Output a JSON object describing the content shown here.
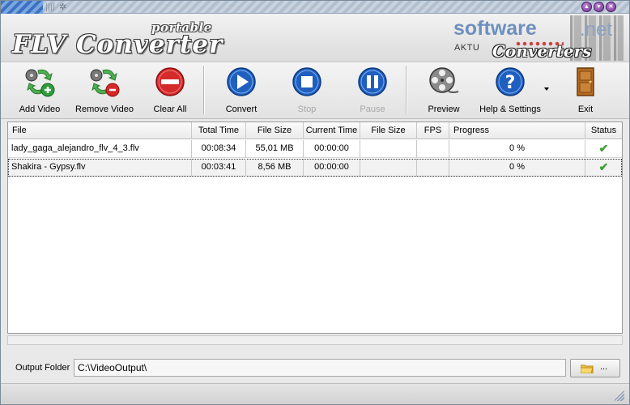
{
  "app": {
    "logo_portable": "portable",
    "logo_title": "FLV Converter",
    "brand_site": "software",
    "brand_tld": ".net",
    "brand_aktu": "AKTU",
    "brand_converters": "Converters",
    "window_controls": [
      "minimize-icon",
      "maximize-icon",
      "close-icon"
    ]
  },
  "toolbar": {
    "add_video": "Add Video",
    "remove_video": "Remove Video",
    "clear_all": "Clear All",
    "convert": "Convert",
    "stop": "Stop",
    "pause": "Pause",
    "preview": "Preview",
    "help_settings": "Help & Settings",
    "exit": "Exit",
    "disabled": [
      "Stop",
      "Pause"
    ]
  },
  "table": {
    "columns": [
      "File",
      "Total Time",
      "File Size",
      "Current Time",
      "File Size",
      "FPS",
      "Progress",
      "Status"
    ],
    "rows": [
      {
        "file": "lady_gaga_alejandro_flv_4_3.flv",
        "total_time": "00:08:34",
        "file_size": "55,01 MB",
        "current_time": "00:00:00",
        "out_size": "",
        "fps": "",
        "progress": "0 %",
        "status": "check-icon"
      },
      {
        "file": "Shakira - Gypsy.flv",
        "total_time": "00:03:41",
        "file_size": "8,56 MB",
        "current_time": "00:00:00",
        "out_size": "",
        "fps": "",
        "progress": "0 %",
        "status": "check-icon"
      }
    ],
    "selected_row": 1
  },
  "output": {
    "label": "Output Folder",
    "path": "C:\\VideoOutput\\",
    "browse_label": "..."
  },
  "colors": {
    "accent_blue": "#1f5fbf",
    "check_green": "#3aa133",
    "remove_red": "#d42a2a"
  }
}
